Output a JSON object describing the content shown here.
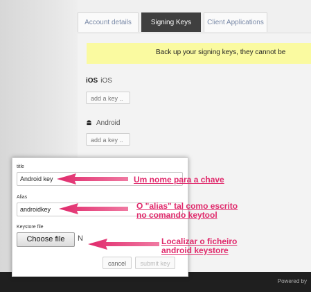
{
  "tabs": [
    {
      "label": "Account details"
    },
    {
      "label": "Signing Keys"
    },
    {
      "label": "Client Applications"
    }
  ],
  "banner": {
    "text": "Back up your signing keys, they cannot be"
  },
  "ios": {
    "icon_text": "iOS",
    "label": "iOS",
    "button": "add a key .."
  },
  "android": {
    "label": "Android",
    "button": "add a key ..",
    "icon": "android-icon"
  },
  "footer": {
    "text": "Powered by"
  },
  "modal": {
    "title_label": "title",
    "title_value": "Android key",
    "alias_label": "Alias",
    "alias_value": "androidkey",
    "keystore_label": "Keystore file",
    "file_button": "Choose file",
    "file_status": "N",
    "cancel": "cancel",
    "submit": "submit key"
  },
  "annotations": {
    "title": "Um nome para a chave",
    "alias_line1": "O \"alias\" tal como escrito",
    "alias_line2": "no comando keytool",
    "keystore_line1": "Localizar o ficheiro",
    "keystore_line2": "android keystore"
  },
  "colors": {
    "annotation": "#e0296b",
    "banner": "#fafaa0",
    "active_tab": "#3f3f3f"
  }
}
